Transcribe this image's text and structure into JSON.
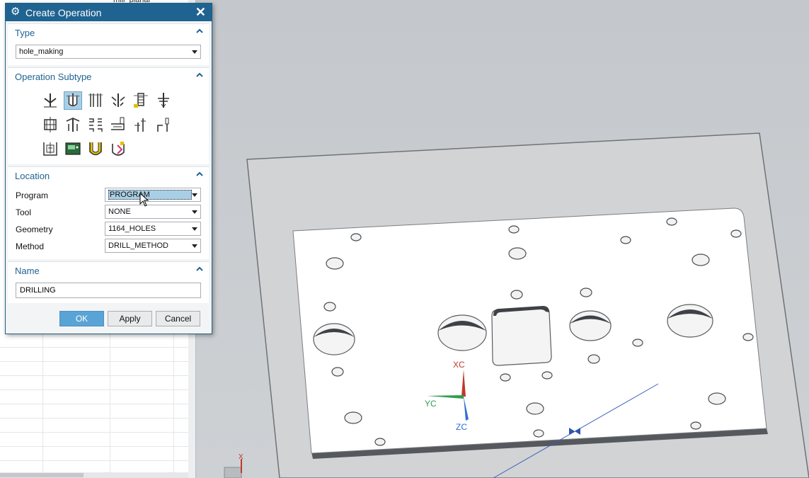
{
  "background": {
    "navigator_header_text": "mill_planar"
  },
  "dialog": {
    "title": "Create Operation",
    "type_section": {
      "title": "Type",
      "selected": "hole_making"
    },
    "subtype_section": {
      "title": "Operation Subtype",
      "icons": [
        "spot-drill-icon",
        "drill-icon",
        "peck-drill-icon",
        "counter-bore-icon",
        "tap-icon",
        "hole-mill-icon",
        "thread-mill-icon",
        "boss-mill-icon",
        "back-counter-sink-icon",
        "hole-chamfer-icon",
        "sequential-drill-icon",
        "cylinder-milling-icon",
        "hole-feature-icon",
        "process-icon",
        "bore-icon",
        "ream-icon"
      ],
      "selected_icon": "drill-icon"
    },
    "location_section": {
      "title": "Location",
      "fields": [
        {
          "label": "Program",
          "value": "PROGRAM"
        },
        {
          "label": "Tool",
          "value": "NONE"
        },
        {
          "label": "Geometry",
          "value": "1164_HOLES"
        },
        {
          "label": "Method",
          "value": "DRILL_METHOD"
        }
      ]
    },
    "name_section": {
      "title": "Name",
      "value": "DRILLING"
    },
    "buttons": {
      "ok": "OK",
      "apply": "Apply",
      "cancel": "Cancel"
    }
  },
  "viewport": {
    "axes": {
      "xc": "XC",
      "yc": "YC",
      "zc": "ZC",
      "x": "X"
    },
    "colors": {
      "xc": "#c0392b",
      "yc": "#2e9e4f",
      "zc": "#2f6fd6",
      "selection": "#a9cfe6",
      "accent": "#1f6391"
    }
  }
}
